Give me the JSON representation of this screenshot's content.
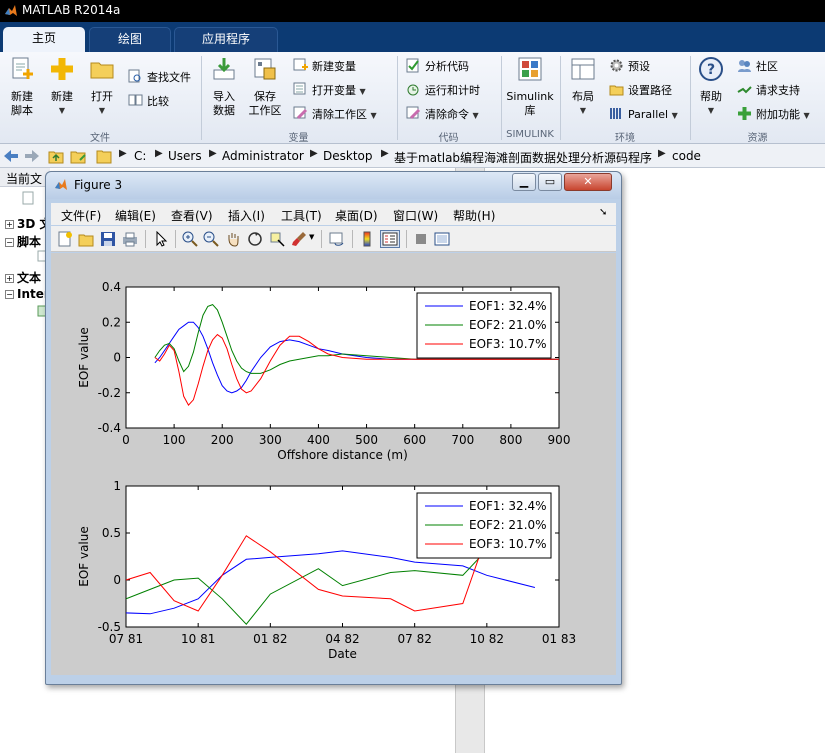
{
  "app": {
    "title": "MATLAB R2014a"
  },
  "tabs": [
    {
      "label": "主页",
      "active": true
    },
    {
      "label": "绘图",
      "active": false
    },
    {
      "label": "应用程序",
      "active": false
    }
  ],
  "ribbon": {
    "file": {
      "new_script": [
        "新建",
        "脚本"
      ],
      "new": "新建",
      "open": "打开",
      "find_files": "查找文件",
      "compare": "比较",
      "group": "文件"
    },
    "variable": {
      "import": [
        "导入",
        "数据"
      ],
      "save_ws": [
        "保存",
        "工作区"
      ],
      "new_var": "新建变量",
      "open_var": "打开变量",
      "clear_ws": "清除工作区",
      "group": "变量"
    },
    "code": {
      "analyze": "分析代码",
      "run_time": "运行和计时",
      "clear_cmd": "清除命令",
      "group": "代码"
    },
    "simulink": {
      "lib": [
        "Simulink",
        "库"
      ],
      "group": "SIMULINK"
    },
    "env": {
      "layout": "布局",
      "prefs": "预设",
      "set_path": "设置路径",
      "parallel": "Parallel",
      "group": "环境"
    },
    "resources": {
      "help": "帮助",
      "community": "社区",
      "support": "请求支持",
      "addons": "附加功能",
      "group": "资源"
    }
  },
  "address": {
    "crumbs": [
      "C:",
      "Users",
      "Administrator",
      "Desktop",
      "基于matlab编程海滩剖面数据处理分析源码程序",
      "code"
    ]
  },
  "left_panel": {
    "header": "当前文",
    "rows": [
      {
        "box": "+",
        "label": "3D 文"
      },
      {
        "box": "−",
        "label": "脚本"
      },
      {
        "box": "+",
        "label": "文本"
      },
      {
        "box": "−",
        "label": "Inter"
      }
    ]
  },
  "figure": {
    "title": "Figure 3",
    "menu": [
      "文件(F)",
      "编辑(E)",
      "查看(V)",
      "插入(I)",
      "工具(T)",
      "桌面(D)",
      "窗口(W)",
      "帮助(H)"
    ]
  },
  "colors": {
    "eof1": "#0000ff",
    "eof2": "#008000",
    "eof3": "#ff0000",
    "ribbon_tab_bg": "#0c3a73",
    "canvas_bg": "#cccccc"
  },
  "chart_data": [
    {
      "type": "line",
      "xlabel": "Offshore distance (m)",
      "ylabel": "EOF value",
      "xlim": [
        0,
        900
      ],
      "ylim": [
        -0.4,
        0.4
      ],
      "xticks": [
        "0",
        "100",
        "200",
        "300",
        "400",
        "500",
        "600",
        "700",
        "800",
        "900"
      ],
      "yticks": [
        "-0.4",
        "-0.2",
        "0",
        "0.2",
        "0.4"
      ],
      "legend_position": "top-right",
      "series": [
        {
          "name": "EOF1: 32.4%",
          "color": "#0000ff",
          "x": [
            60,
            70,
            80,
            90,
            100,
            110,
            120,
            130,
            140,
            150,
            160,
            170,
            180,
            190,
            200,
            210,
            220,
            230,
            240,
            250,
            260,
            280,
            300,
            320,
            340,
            360,
            380,
            400,
            420,
            450,
            500,
            550,
            600,
            650,
            700,
            750,
            800,
            850,
            900
          ],
          "y": [
            -0.03,
            0.0,
            0.04,
            0.08,
            0.12,
            0.16,
            0.18,
            0.2,
            0.2,
            0.17,
            0.12,
            0.05,
            -0.03,
            -0.1,
            -0.16,
            -0.19,
            -0.2,
            -0.19,
            -0.17,
            -0.13,
            -0.08,
            0.0,
            0.06,
            0.09,
            0.1,
            0.09,
            0.07,
            0.05,
            0.04,
            0.02,
            0.0,
            -0.01,
            -0.01,
            -0.01,
            -0.01,
            -0.01,
            -0.01,
            -0.01,
            -0.01
          ]
        },
        {
          "name": "EOF2: 21.0%",
          "color": "#008000",
          "x": [
            60,
            70,
            80,
            90,
            100,
            110,
            120,
            130,
            140,
            150,
            160,
            170,
            180,
            190,
            200,
            210,
            220,
            230,
            240,
            250,
            260,
            280,
            300,
            320,
            340,
            360,
            380,
            400,
            420,
            450,
            500,
            550,
            600,
            650,
            700,
            750,
            800,
            850,
            900
          ],
          "y": [
            0.0,
            0.04,
            0.07,
            0.08,
            0.05,
            -0.02,
            -0.08,
            -0.05,
            0.03,
            0.14,
            0.24,
            0.29,
            0.3,
            0.27,
            0.2,
            0.12,
            0.04,
            -0.02,
            -0.06,
            -0.08,
            -0.09,
            -0.09,
            -0.07,
            -0.04,
            -0.02,
            -0.01,
            0.0,
            0.01,
            0.01,
            0.02,
            0.01,
            0.0,
            -0.01,
            -0.01,
            -0.01,
            -0.01,
            -0.01,
            -0.01,
            -0.01
          ]
        },
        {
          "name": "EOF3: 10.7%",
          "color": "#ff0000",
          "x": [
            60,
            70,
            80,
            90,
            100,
            110,
            120,
            130,
            140,
            150,
            160,
            170,
            180,
            190,
            200,
            210,
            220,
            230,
            240,
            250,
            260,
            280,
            300,
            320,
            340,
            360,
            380,
            400,
            420,
            450,
            500,
            550,
            600,
            650,
            700,
            750,
            800,
            850,
            900
          ],
          "y": [
            0.0,
            -0.02,
            0.02,
            0.07,
            0.04,
            -0.08,
            -0.22,
            -0.27,
            -0.24,
            -0.15,
            -0.05,
            0.04,
            0.1,
            0.13,
            0.11,
            0.05,
            -0.04,
            -0.12,
            -0.18,
            -0.2,
            -0.19,
            -0.12,
            -0.02,
            0.07,
            0.12,
            0.12,
            0.09,
            0.05,
            0.02,
            0.0,
            -0.01,
            -0.01,
            -0.01,
            -0.01,
            -0.01,
            -0.01,
            -0.01,
            -0.01,
            -0.01
          ]
        }
      ]
    },
    {
      "type": "line",
      "xlabel": "Date",
      "ylabel": "EOF value",
      "xlim": [
        "07 81",
        "01 83"
      ],
      "ylim": [
        -0.5,
        1
      ],
      "xticks": [
        "07 81",
        "10 81",
        "01 82",
        "04 82",
        "07 82",
        "10 82",
        "01 83"
      ],
      "yticks": [
        "-0.5",
        "0",
        "0.5",
        "1"
      ],
      "legend_position": "top-right",
      "series": [
        {
          "name": "EOF1: 32.4%",
          "color": "#0000ff",
          "x": [
            "07 81",
            "08 81",
            "09 81",
            "10 81",
            "11 81",
            "12 81",
            "01 82",
            "03 82",
            "04 82",
            "06 82",
            "07 82",
            "09 82",
            "10 82",
            "12 82"
          ],
          "y": [
            -0.35,
            -0.36,
            -0.3,
            -0.2,
            0.05,
            0.22,
            0.24,
            0.28,
            0.31,
            0.24,
            0.19,
            0.15,
            0.05,
            -0.08
          ]
        },
        {
          "name": "EOF2: 21.0%",
          "color": "#008000",
          "x": [
            "07 81",
            "08 81",
            "09 81",
            "10 81",
            "11 81",
            "12 81",
            "01 82",
            "03 82",
            "04 82",
            "06 82",
            "07 82",
            "09 82",
            "10 82"
          ],
          "y": [
            -0.2,
            -0.1,
            0.0,
            0.02,
            -0.2,
            -0.47,
            -0.15,
            0.12,
            -0.06,
            0.08,
            0.1,
            0.05,
            0.32
          ]
        },
        {
          "name": "EOF3: 10.7%",
          "color": "#ff0000",
          "x": [
            "07 81",
            "08 81",
            "09 81",
            "10 81",
            "11 81",
            "12 81",
            "01 82",
            "03 82",
            "04 82",
            "06 82",
            "07 82",
            "09 82",
            "10 82"
          ],
          "y": [
            0.0,
            0.08,
            -0.22,
            -0.33,
            0.05,
            0.47,
            0.3,
            -0.1,
            -0.17,
            -0.2,
            -0.33,
            -0.25,
            0.48
          ]
        }
      ]
    }
  ]
}
